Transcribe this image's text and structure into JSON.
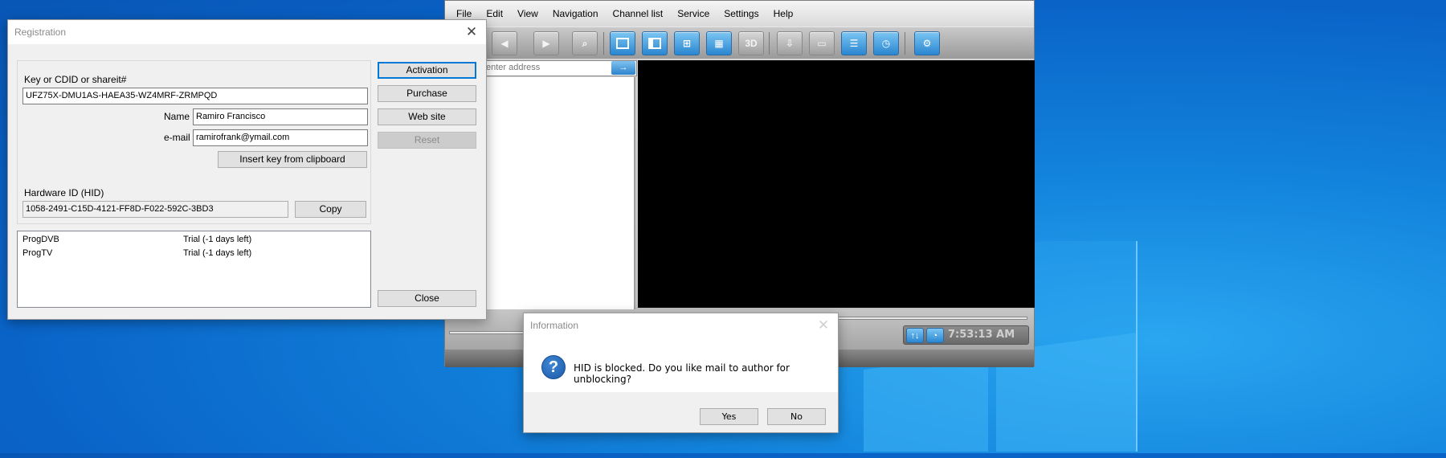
{
  "desktop": {
    "accent": "#0a64c8"
  },
  "progdvb": {
    "menu": [
      "File",
      "Edit",
      "View",
      "Navigation",
      "Channel list",
      "Service",
      "Settings",
      "Help"
    ],
    "toolbar_icons": [
      "back-icon",
      "forward-icon",
      "search-icon",
      "single-view-icon",
      "dual-view-icon",
      "quad-view-icon",
      "grid-view-icon",
      "3d-icon",
      "record-icon",
      "teletext-icon",
      "list-icon",
      "schedule-icon",
      "settings-gear-icon"
    ],
    "toolbar_3d_label": "3D",
    "address_placeholder": "enter address",
    "clock": "7:53:13 AM"
  },
  "registration": {
    "title": "Registration",
    "key_label": "Key or CDID or shareit#",
    "key_value": "UFZ75X-DMU1AS-HAEA35-WZ4MRF-ZRMPQD",
    "name_label": "Name",
    "name_value": "Ramiro Francisco",
    "email_label": "e-mail",
    "email_value": "ramirofrank@ymail.com",
    "insert_key_button": "Insert key from clipboard",
    "hid_label": "Hardware ID (HID)",
    "hid_value": "1058-2491-C15D-4121-FF8D-F022-592C-3BD3",
    "copy_button": "Copy",
    "activation_button": "Activation",
    "purchase_button": "Purchase",
    "website_button": "Web site",
    "reset_button": "Reset",
    "close_button": "Close",
    "licenses": [
      {
        "product": "ProgDVB",
        "status": "Trial (-1 days left)"
      },
      {
        "product": "ProgTV",
        "status": "Trial (-1 days left)"
      }
    ]
  },
  "information": {
    "title": "Information",
    "message": "HID is blocked. Do you like mail to author for unblocking?",
    "yes_button": "Yes",
    "no_button": "No"
  }
}
